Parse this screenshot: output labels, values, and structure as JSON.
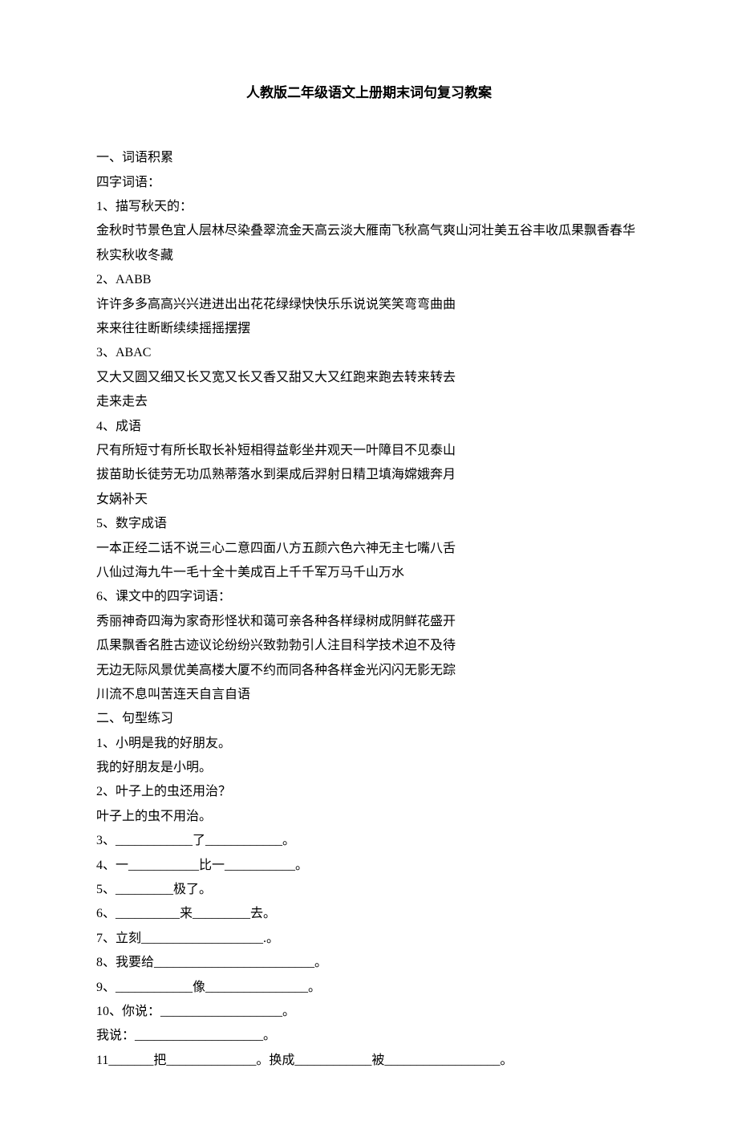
{
  "title": "人教版二年级语文上册期末词句复习教案",
  "lines": [
    "一、词语积累",
    "四字词语：",
    "1、描写秋天的：",
    "金秋时节景色宜人层林尽染叠翠流金天高云淡大雁南飞秋高气爽山河壮美五谷丰收瓜果飘香春华秋实秋收冬藏",
    "2、AABB",
    "许许多多高高兴兴进进出出花花绿绿快快乐乐说说笑笑弯弯曲曲",
    "来来往往断断续续摇摇摆摆",
    "3、ABAC",
    "又大又圆又细又长又宽又长又香又甜又大又红跑来跑去转来转去",
    "走来走去",
    "4、成语",
    "尺有所短寸有所长取长补短相得益彰坐井观天一叶障目不见泰山",
    "拔苗助长徒劳无功瓜熟蒂落水到渠成后羿射日精卫填海嫦娥奔月",
    "女娲补天",
    "5、数字成语",
    "一本正经二话不说三心二意四面八方五颜六色六神无主七嘴八舌",
    "八仙过海九牛一毛十全十美成百上千千军万马千山万水",
    "6、课文中的四字词语：",
    "秀丽神奇四海为家奇形怪状和蔼可亲各种各样绿树成阴鲜花盛开",
    "瓜果飘香名胜古迹议论纷纷兴致勃勃引人注目科学技术迫不及待",
    "无边无际风景优美高楼大厦不约而同各种各样金光闪闪无影无踪",
    "川流不息叫苦连天自言自语",
    "二、句型练习",
    "1、小明是我的好朋友。",
    "我的好朋友是小明。",
    "2、叶子上的虫还用治？",
    "叶子上的虫不用治。",
    "3、____________了____________。",
    "4、一___________比一___________。",
    "5、_________极了。",
    "6、__________来_________去。",
    "7、立刻___________________.。",
    "8、我要给_________________________。",
    "9、____________像________________。",
    "10、你说：___________________。",
    "我说：____________________。",
    "11_______把______________。换成____________被__________________。"
  ]
}
